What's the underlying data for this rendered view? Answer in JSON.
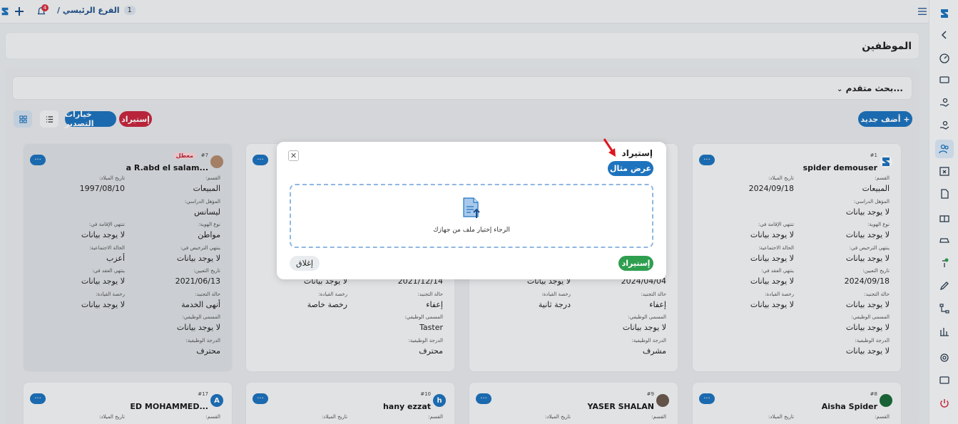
{
  "topbar": {
    "breadcrumb_label": "الفرع الرئيسي /",
    "breadcrumb_num": "1",
    "notif_count": "4"
  },
  "page": {
    "title": "الموظفين"
  },
  "filters": {
    "advanced_label": "بحث متقدم..."
  },
  "toolbar": {
    "add_new": "أضف جديد",
    "import": "إستيراد",
    "export": "خيارات التصدير"
  },
  "cards": [
    {
      "id": "#1",
      "name": "spider demouser",
      "dept": "المبيعات",
      "birth": "2024/09/18",
      "qual": "لا يوجد بيانات",
      "id_type": "لا يوجد بيانات",
      "res_end": "لا يوجد بيانات",
      "lic_end": "لا يوجد بيانات",
      "marital": "لا يوجد بيانات",
      "hire": "2024/09/18",
      "contract_end": "لا يوجد بيانات",
      "drv_status": "لا يوجد بيانات",
      "drv_lic": "لا يوجد بيانات",
      "job_title": "لا يوجد بيانات",
      "grade": "لا يوجد بيانات"
    },
    {
      "hire": "2024/04/04",
      "contract_end": "لا يوجد بيانات",
      "drv_status": "إعفاء",
      "drv_lic": "درجة ثانية",
      "job_title": "لا يوجد بيانات",
      "grade": "مشرف"
    },
    {
      "hire": "2021/12/14",
      "contract_end": "لا يوجد بيانات",
      "drv_status": "إعفاء",
      "drv_lic": "رخصة خاصة",
      "job_title": "Taster",
      "grade": "محترف"
    },
    {
      "id": "#7",
      "name": "a R.abd el salam...",
      "status": "معطل",
      "dept": "المبيعات",
      "birth": "1997/08/10",
      "qual": "ليسانس",
      "id_type": "مواطن",
      "res_end": "لا يوجد بيانات",
      "lic_end": "لا يوجد بيانات",
      "marital": "أعزب",
      "hire": "2021/06/13",
      "contract_end": "لا يوجد بيانات",
      "drv_status": "أنهى الخدمة",
      "drv_lic": "لا يوجد بيانات",
      "job_title": "لا يوجد بيانات",
      "grade": "محترف"
    }
  ],
  "bottom_cards": [
    {
      "id": "#8",
      "name": "Aisha Spider"
    },
    {
      "id": "#9",
      "name": "YASER SHALAN"
    },
    {
      "id": "#10",
      "name": "hany ezzat",
      "initial": "h"
    },
    {
      "id": "#17",
      "name": "ED MOHAMMED...",
      "initial": "A"
    }
  ],
  "labels": {
    "dept": "القسم:",
    "birth": "تاريخ الميلاد:",
    "qual": "المؤهل الدراسي:",
    "id_type": "نوع الهوية:",
    "res_end": "تنتهي الإقامة في:",
    "lic_end": "ينتهي الترخيص في:",
    "marital": "الحالة الاجتماعية:",
    "hire": "تاريخ التعيين:",
    "contract_end": "ينتهي العقد في:",
    "drv_status": "حالة التجنيد:",
    "drv_lic": "رخصة القيادة:",
    "job_title": "المسمى الوظيفي:",
    "grade": "الدرجة الوظيفية:"
  },
  "modal": {
    "title": "إستيراد",
    "example_btn": "عرض مثال",
    "dropzone_text": "الرجاء إختيار ملف من جهازك",
    "import_btn": "إستيراد",
    "close_btn": "إغلاق"
  },
  "colors": {
    "primary": "#1e73be",
    "danger": "#d62e3f",
    "success": "#2e9e4f"
  }
}
